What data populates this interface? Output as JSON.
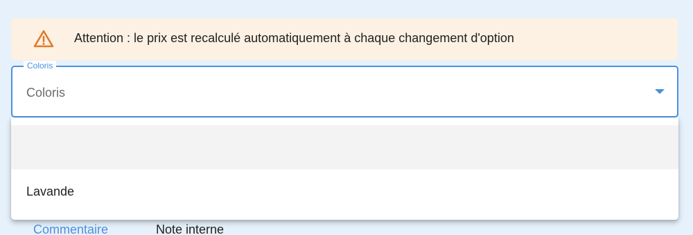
{
  "alert": {
    "icon": "warning-triangle-icon",
    "icon_color": "#e07a2d",
    "background": "#fcf1e2",
    "text": "Attention : le prix est recalculé automatiquement à chaque changement d'option"
  },
  "select": {
    "label": "Coloris",
    "placeholder": "Coloris",
    "accent_color": "#4a90e2",
    "expanded": true,
    "options": [
      {
        "label": "",
        "highlighted": true
      },
      {
        "label": "Lavande",
        "highlighted": false
      }
    ]
  },
  "tabs": [
    {
      "label": "Commentaire",
      "active": true
    },
    {
      "label": "Note interne",
      "active": false
    }
  ]
}
